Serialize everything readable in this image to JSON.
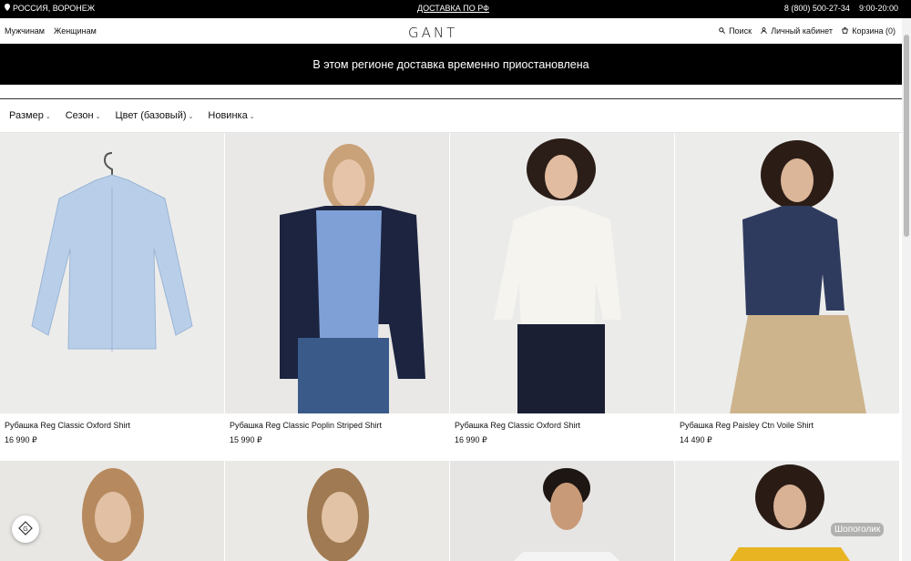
{
  "topbar": {
    "location": "РОССИЯ, ВОРОНЕЖ",
    "shipping": "ДОСТАВКА ПО РФ",
    "phone": "8 (800) 500-27-34",
    "hours": "9:00-20:00"
  },
  "nav": {
    "men": "Мужчинам",
    "women": "Женщинам",
    "logo": "GANT",
    "search": "Поиск",
    "account": "Личный кабинет",
    "cart": "Корзина (0)"
  },
  "banner": {
    "text": "В этом регионе доставка временно приостановлена"
  },
  "filters": [
    {
      "label": "Размер"
    },
    {
      "label": "Сезон"
    },
    {
      "label": "Цвет (базовый)"
    },
    {
      "label": "Новинка"
    }
  ],
  "products": [
    {
      "name": "Рубашка Reg Classic Oxford Shirt",
      "price": "16 990 ₽"
    },
    {
      "name": "Рубашка Reg Classic Poplin Striped Shirt",
      "price": "15 990 ₽"
    },
    {
      "name": "Рубашка Reg Classic Oxford Shirt",
      "price": "16 990 ₽"
    },
    {
      "name": "Рубашка Reg Paisley Ctn Voile Shirt",
      "price": "14 490 ₽"
    }
  ],
  "watermark": "Шопоголик",
  "colors": {
    "topbar": "#000000",
    "banner": "#000000",
    "image_bg": "#ececeb"
  }
}
